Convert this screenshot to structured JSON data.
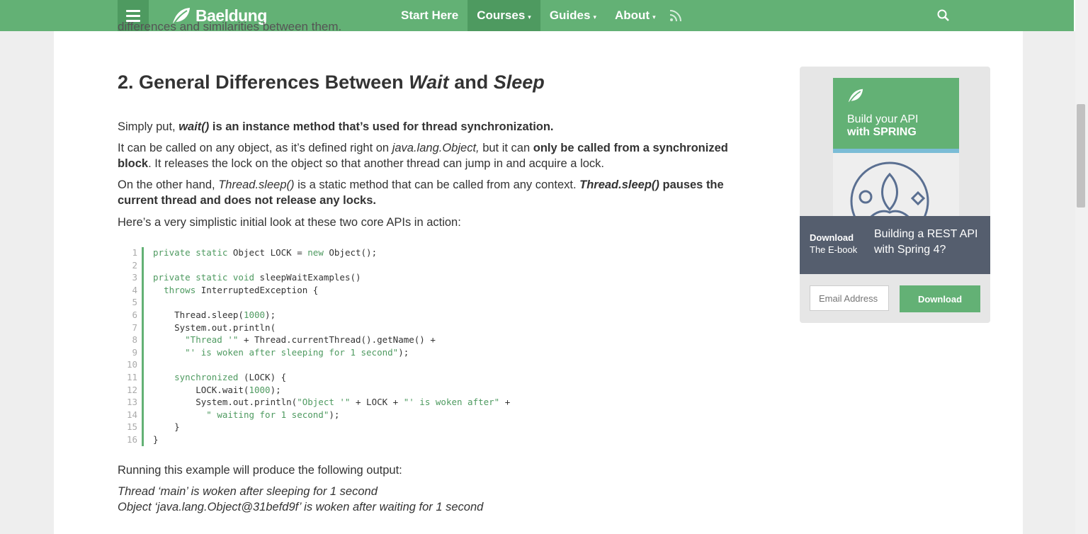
{
  "nav": {
    "logo": "Baeldung",
    "items": [
      {
        "label": "Start Here",
        "caret": ""
      },
      {
        "label": "Courses",
        "caret": "▾"
      },
      {
        "label": "Guides",
        "caret": "▾"
      },
      {
        "label": "About",
        "caret": "▾"
      }
    ],
    "accent": "#63b175",
    "accent_dark": "#4e9a60"
  },
  "article": {
    "cut_line": "differences and similarities between them.",
    "heading": {
      "prefix": "2. General Differences Between ",
      "w1": "Wait",
      "mid": " and ",
      "w2": "Sleep"
    },
    "p1": {
      "a": "Simply put, ",
      "b": "wait()",
      "c": " is an instance method that’s used for thread synchronization."
    },
    "p2": {
      "a": "It can be called on any object, as it’s defined right on ",
      "b": "java.lang.Object,",
      "c": " but it can ",
      "d": "only be called from a synchronized block",
      "e": ". It releases the lock on the object so that another thread can jump in and acquire a lock."
    },
    "p3": {
      "a": "On the other hand, ",
      "b": "Thread.sleep()",
      "c": " is a static method that can be called from any context. ",
      "d": "Thread.sleep()",
      "e": " pauses the current thread and does not release any locks."
    },
    "p4": "Here’s a very simplistic initial look at these two core APIs in action:",
    "code_lines": [
      "private static Object LOCK = new Object();",
      "",
      "private static void sleepWaitExamples()",
      "  throws InterruptedException {",
      "",
      "    Thread.sleep(1000);",
      "    System.out.println(",
      "      \"Thread '\" + Thread.currentThread().getName() +",
      "      \"' is woken after sleeping for 1 second\");",
      "",
      "    synchronized (LOCK) {",
      "        LOCK.wait(1000);",
      "        System.out.println(\"Object '\" + LOCK + \"' is woken after\" +",
      "          \" waiting for 1 second\");",
      "    }",
      "}"
    ],
    "p5": "Running this example will produce the following output:",
    "output1": "Thread ‘main’ is woken after sleeping for 1 second",
    "output2": "Object ‘java.lang.Object@31befd9f’ is woken after waiting for 1 second"
  },
  "ad": {
    "book_title_1": "Build your API",
    "book_title_2": "with SPRING",
    "download_bold": "Download",
    "download_sub": "The E-book",
    "headline": "Building a REST API with Spring 4?",
    "email_placeholder": "Email Address",
    "button": "Download"
  }
}
